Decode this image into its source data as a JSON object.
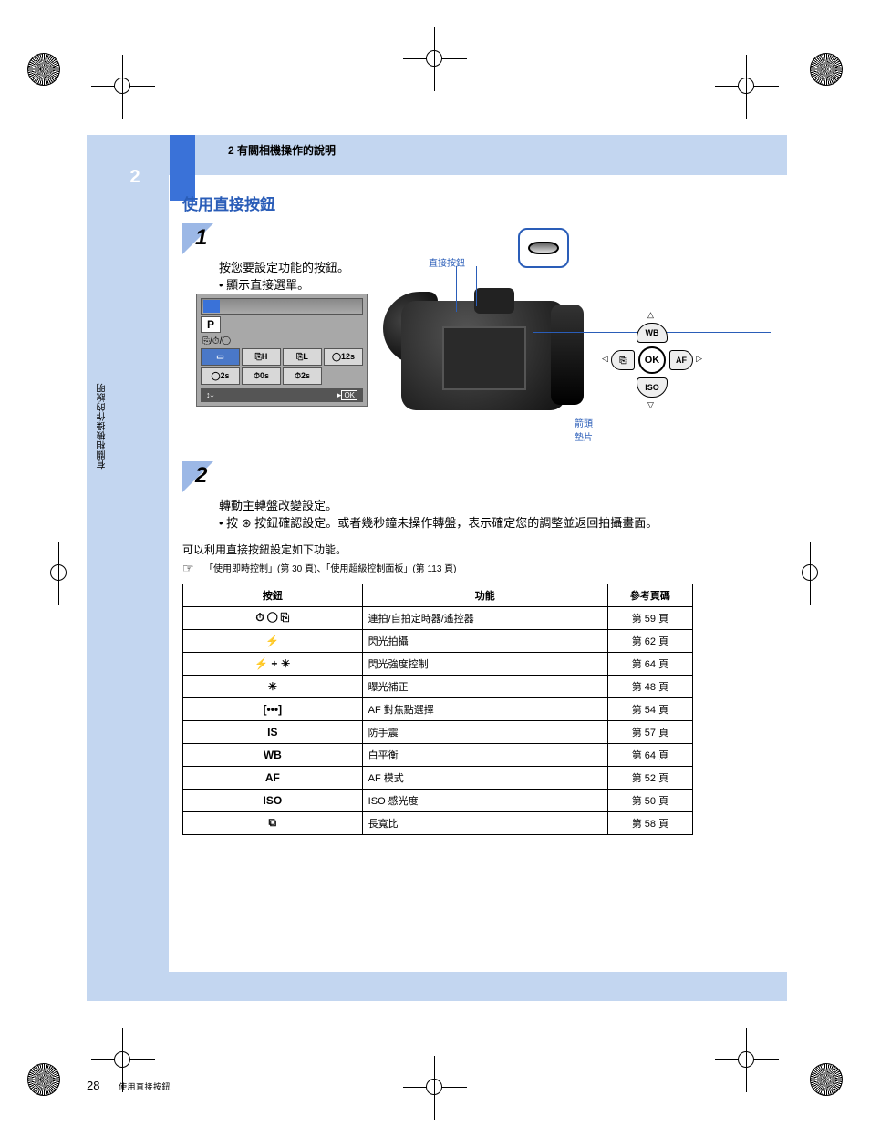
{
  "page": {
    "number": "28",
    "label": "使用直接按鈕",
    "chapter_num": "2",
    "side_label": "有關相機操作的說明"
  },
  "header": {
    "chapter": "2 有關相機操作的說明"
  },
  "section": {
    "title": "使用直接按鈕"
  },
  "step1": {
    "num": "1",
    "text_line1": "按您要設定功能的按鈕。",
    "text_line2": "• 顯示直接選單。",
    "lcd": {
      "mode": "P",
      "menu_label": "⎘/⏱/◯",
      "row1": [
        "▭",
        "⎘H",
        "⎘L",
        "◯12s"
      ],
      "row2": [
        "◯2s",
        "⏱0s",
        "⏱2s"
      ],
      "footer_left": "↕⤓",
      "footer_right_arrow": "▸",
      "footer_ok": "OK"
    },
    "dial_label": "◡",
    "buttons_label": "直接按鈕",
    "arrowpad_label": "箭頭墊片",
    "arrowpad": {
      "center": "OK",
      "up": "WB",
      "down": "ISO",
      "left": "⎘",
      "right": "AF"
    }
  },
  "step2": {
    "num": "2",
    "text_line1": "轉動主轉盤改變設定。",
    "text_line2": "• 按 ⊛ 按鈕確認設定。或者幾秒鐘未操作轉盤，表示確定您的調整並返回拍攝畫面。"
  },
  "table_intro": "可以利用直接按鈕設定如下功能。",
  "xref": "「使用即時控制」(第 30 頁)、「使用超級控制面板」(第 113 頁)",
  "table": {
    "headers": [
      "按鈕",
      "功能",
      "參考頁碼"
    ],
    "rows": [
      {
        "btn_icon": "⏱ ◯ ⎘",
        "func": "連拍/自拍定時器/遙控器",
        "page": "第 59 頁"
      },
      {
        "btn_icon": "⚡",
        "func": "閃光拍攝",
        "page": "第 62 頁"
      },
      {
        "btn_icon": "⚡ + ☀",
        "func": "閃光強度控制",
        "page": "第 64 頁"
      },
      {
        "btn_icon": "☀",
        "func": "曝光補正",
        "page": "第 48 頁"
      },
      {
        "btn_icon": "[•••]",
        "func": "AF 對焦點選擇",
        "page": "第 54 頁"
      },
      {
        "btn_icon": "IS",
        "func": "防手震",
        "page": "第 57 頁"
      },
      {
        "btn_icon": "WB",
        "func": "白平衡",
        "page": "第 64 頁"
      },
      {
        "btn_icon": "AF",
        "func": "AF 模式",
        "page": "第 52 頁"
      },
      {
        "btn_icon": "ISO",
        "func": "ISO 感光度",
        "page": "第 50 頁"
      },
      {
        "btn_icon": "⧉",
        "func": "長寬比",
        "page": "第 58 頁"
      }
    ]
  }
}
